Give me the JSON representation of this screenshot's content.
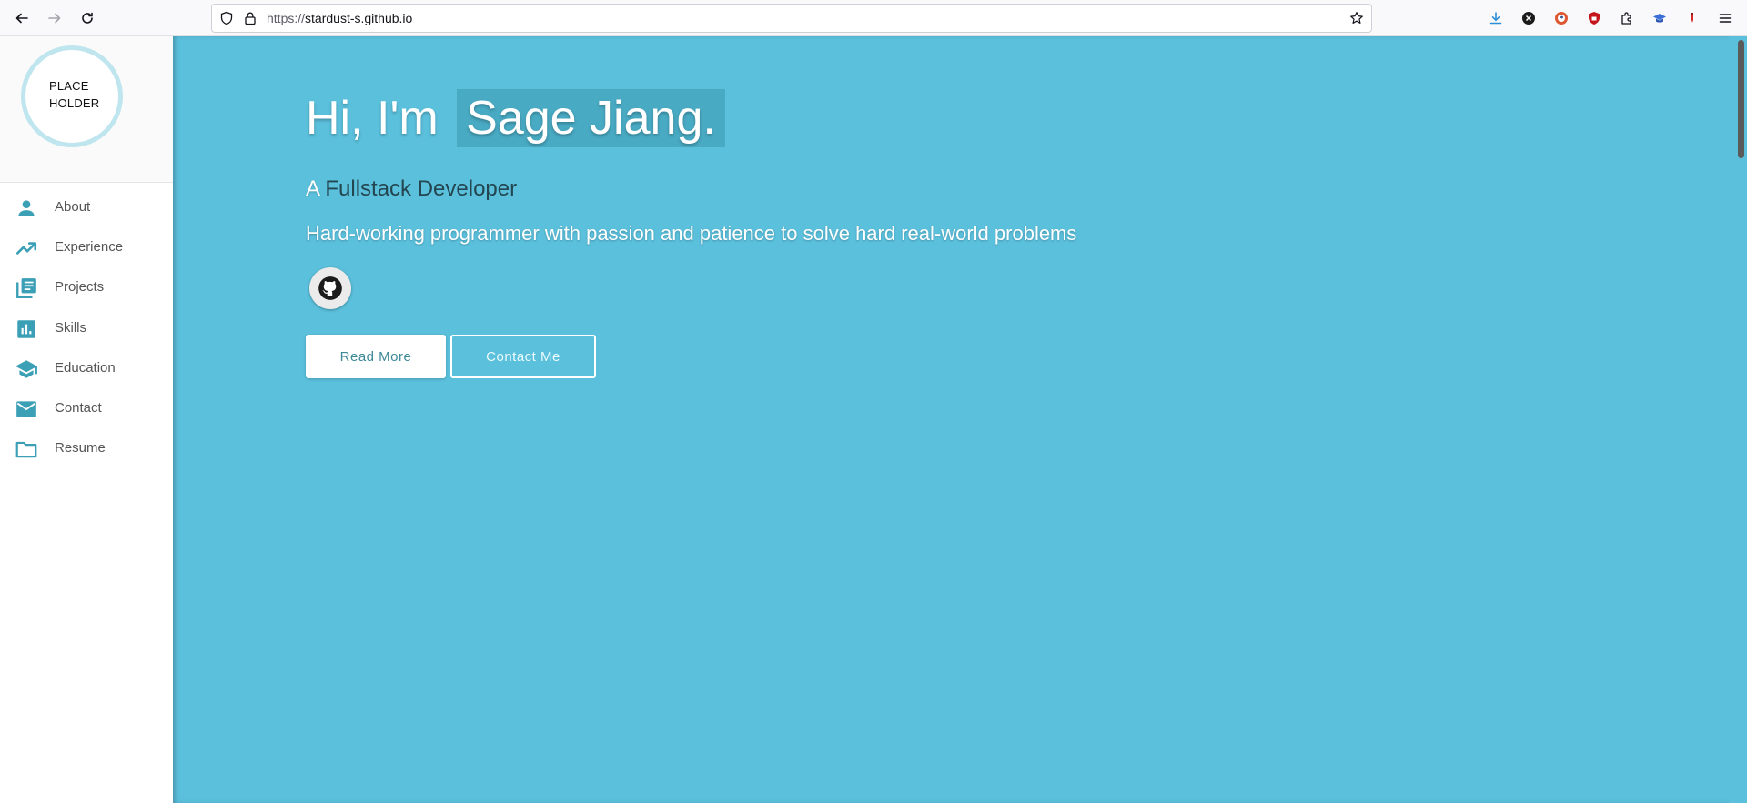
{
  "browser": {
    "url_protocol": "https://",
    "url_host": "stardust-s.github.io",
    "icons": [
      "back-arrow-icon",
      "forward-arrow-icon",
      "reload-icon",
      "shield-icon",
      "lock-icon",
      "star-icon",
      "download-icon",
      "x-extension-icon",
      "duckduckgo-icon",
      "ublock-icon",
      "extensions-puzzle-icon",
      "mortarboard-icon",
      "pen-icon",
      "hamburger-menu-icon"
    ]
  },
  "sidebar": {
    "avatar_line1": "PLACE",
    "avatar_line2": "HOLDER",
    "items": [
      {
        "label": "About",
        "icon": "person-icon"
      },
      {
        "label": "Experience",
        "icon": "trending-up-icon"
      },
      {
        "label": "Projects",
        "icon": "library-books-icon"
      },
      {
        "label": "Skills",
        "icon": "bar-chart-icon"
      },
      {
        "label": "Education",
        "icon": "school-icon"
      },
      {
        "label": "Contact",
        "icon": "mail-icon"
      },
      {
        "label": "Resume",
        "icon": "folder-icon"
      }
    ]
  },
  "hero": {
    "greeting": "Hi, I'm",
    "name": "Sage Jiang.",
    "role_prefix": "A",
    "role": "Fullstack Developer",
    "tagline": "Hard-working programmer with passion and patience to solve hard real-world problems",
    "github_icon": "github-icon",
    "read_more_label": "Read More",
    "contact_label": "Contact Me"
  },
  "colors": {
    "hero_bg": "#5bc0dc",
    "accent": "#3b9fb5",
    "avatar_ring": "#bfe6ee"
  }
}
